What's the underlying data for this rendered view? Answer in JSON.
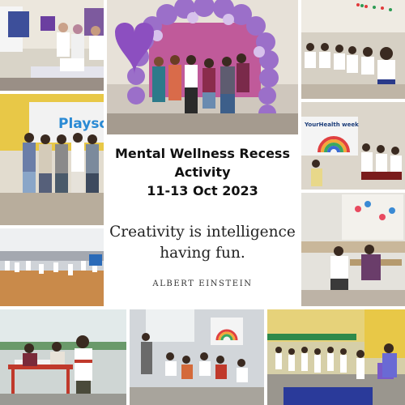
{
  "card": {
    "title_line1": "Mental Wellness Recess",
    "title_line2": "Activity",
    "title_line3": "11-13 Oct 2023",
    "quote_line1": "Creativity is intelligence",
    "quote_line2": "having fun.",
    "author": "ALBERT EINSTEIN"
  },
  "photos": {
    "classroom_poster_sign": "Playsc",
    "screen_slide": "YourHealth week"
  },
  "colors": {
    "background": "#ffffff",
    "balloon_purple": "#9b6fc9",
    "wall_yellow": "#e8c847",
    "floor_wood": "#c98a4a"
  }
}
